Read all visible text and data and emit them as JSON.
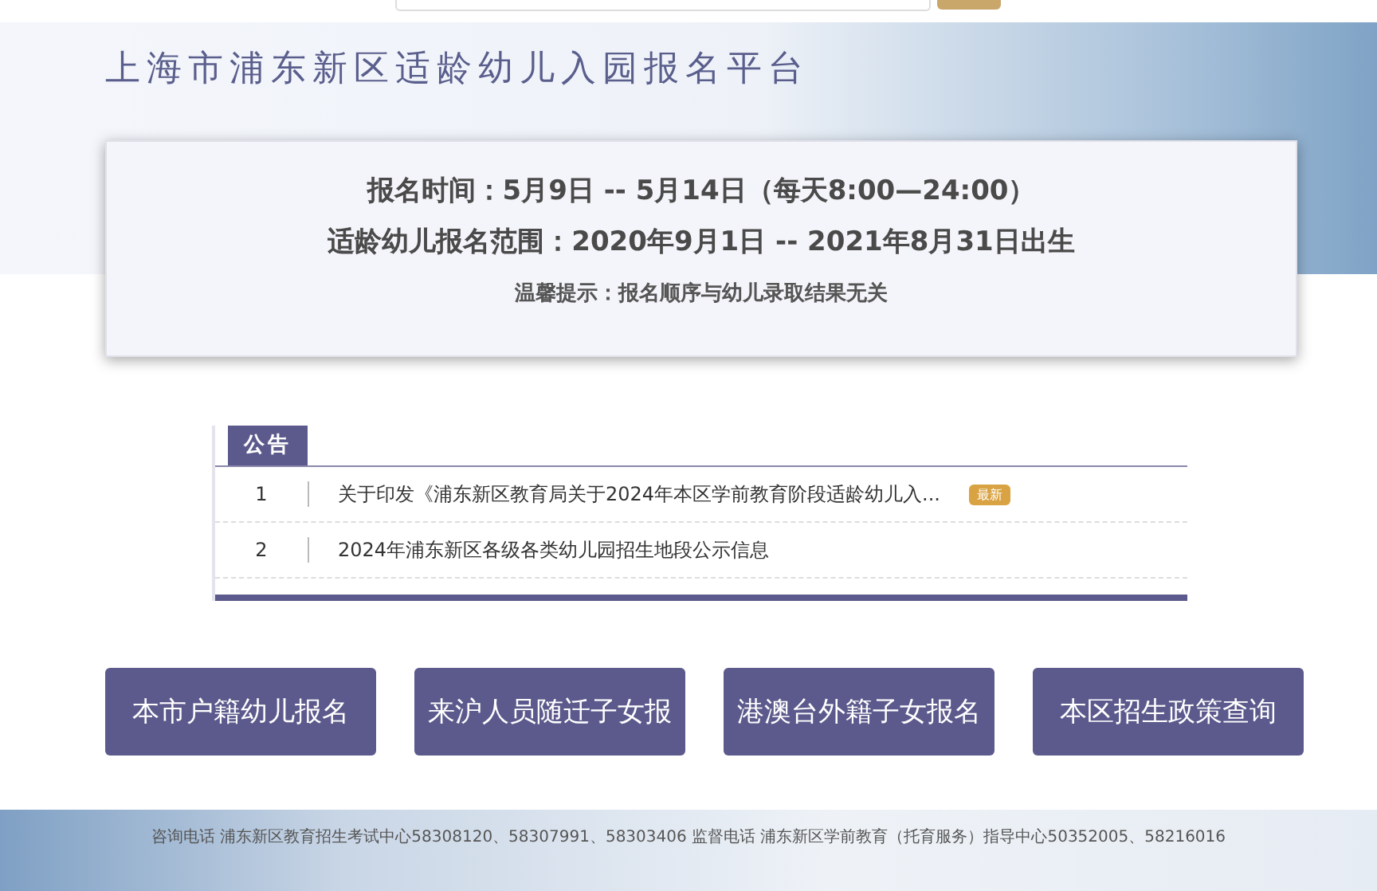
{
  "header": {
    "title": "上海市浦东新区适龄幼儿入园报名平台"
  },
  "info_card": {
    "lines": [
      "报名时间：5月9日 -- 5月14日（每天8:00—24:00）",
      "适龄幼儿报名范围：2020年9月1日 -- 2021年8月31日出生"
    ],
    "tip": "温馨提示：报名顺序与幼儿录取结果无关"
  },
  "notices": {
    "heading": "公告",
    "items": [
      {
        "index": "1",
        "text": "关于印发《浦东新区教育局关于2024年本区学前教育阶段适龄幼儿入...",
        "badge": "最新"
      },
      {
        "index": "2",
        "text": "2024年浦东新区各级各类幼儿园招生地段公示信息"
      }
    ]
  },
  "buttons": [
    "本市户籍幼儿报名",
    "来沪人员随迁子女报",
    "港澳台外籍子女报名",
    "本区招生政策查询"
  ],
  "footer": {
    "contact": "咨询电话 浦东新区教育招生考试中心58308120、58307991、58303406 监督电话 浦东新区学前教育（托育服务）指导中心50352005、58216016"
  }
}
